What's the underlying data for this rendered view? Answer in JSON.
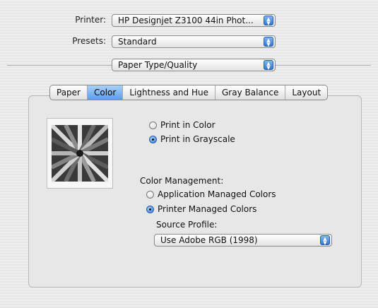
{
  "printer": {
    "label": "Printer:",
    "value": "HP Designjet Z3100 44in Phot..."
  },
  "presets": {
    "label": "Presets:",
    "value": "Standard"
  },
  "pane_selector": {
    "value": "Paper Type/Quality"
  },
  "tabs": [
    {
      "label": "Paper",
      "active": false
    },
    {
      "label": "Color",
      "active": true
    },
    {
      "label": "Lightness and Hue",
      "active": false
    },
    {
      "label": "Gray Balance",
      "active": false
    },
    {
      "label": "Layout",
      "active": false
    }
  ],
  "mode": {
    "color_label": "Print in Color",
    "grayscale_label": "Print in Grayscale",
    "selected": "grayscale"
  },
  "color_management": {
    "heading": "Color Management:",
    "app_label": "Application Managed Colors",
    "printer_label": "Printer Managed Colors",
    "selected": "printer",
    "source_profile_label": "Source Profile:",
    "source_profile_value": "Use Adobe RGB (1998)"
  },
  "icons": {
    "preview": "pencils-grayscale-preview-image",
    "popup": "up-down-arrows-icon"
  },
  "colors": {
    "accent": "#5b9ee6",
    "background": "#ececec"
  }
}
